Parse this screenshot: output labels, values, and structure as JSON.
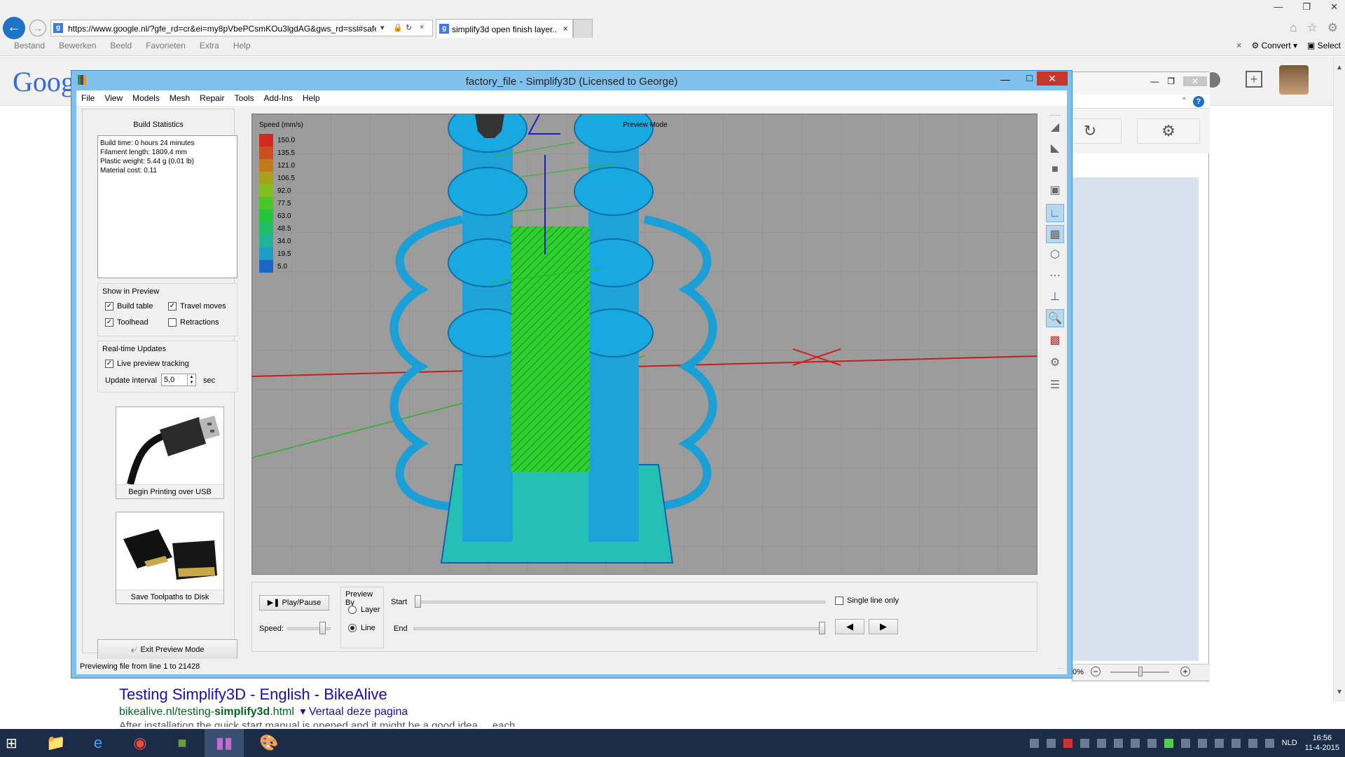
{
  "browser": {
    "url": "https://www.google.nl/?gfe_rd=cr&ei=my8pVbePCsmKOu3lgdAG&gws_rd=ssl#safe=of",
    "tab_title": "simplify3d open finish layer...",
    "menu": [
      "Bestand",
      "Bewerken",
      "Beeld",
      "Favorieten",
      "Extra",
      "Help"
    ],
    "convert_label": "Convert",
    "select_label": "Select"
  },
  "google": {
    "logo": "Goog",
    "result": {
      "title": "Testing Simplify3D - English - BikeAlive",
      "url_prefix": "bikealive.nl/testing-",
      "url_bold": "simplify3d",
      "url_suffix": ".html",
      "translate": "Vertaal deze pagina",
      "snippet": "After installation the quick start manual is opened and it might be a good idea ... each"
    },
    "zoom_pct": "0%"
  },
  "app": {
    "title": "factory_file - Simplify3D (Licensed to George)",
    "menu": [
      "File",
      "View",
      "Models",
      "Mesh",
      "Repair",
      "Tools",
      "Add-Ins",
      "Help"
    ],
    "status": "Previewing file from line 1 to 21428"
  },
  "build_stats": {
    "title": "Build Statistics",
    "lines": [
      "Build time: 0 hours 24 minutes",
      "Filament length: 1809.4 mm",
      "Plastic weight: 5.44 g (0.01 lb)",
      "Material cost: 0.11"
    ]
  },
  "show_in_preview": {
    "title": "Show in Preview",
    "build_table": {
      "label": "Build table",
      "checked": true
    },
    "travel_moves": {
      "label": "Travel moves",
      "checked": true
    },
    "toolhead": {
      "label": "Toolhead",
      "checked": true
    },
    "retractions": {
      "label": "Retractions",
      "checked": false
    }
  },
  "realtime": {
    "title": "Real-time Updates",
    "live_preview": {
      "label": "Live preview tracking",
      "checked": true
    },
    "interval_label": "Update interval",
    "interval_value": "5,0",
    "interval_unit": "sec"
  },
  "actions": {
    "usb_label": "Begin Printing over USB",
    "sd_label": "Save Toolpaths to Disk",
    "exit_label": "Exit Preview Mode"
  },
  "viewport": {
    "mode_label": "Preview Mode",
    "legend_title": "Speed (mm/s)",
    "legend": [
      {
        "value": "150.0",
        "color": "#d42a1e"
      },
      {
        "value": "135.5",
        "color": "#c9501c"
      },
      {
        "value": "121.0",
        "color": "#bf7a1a"
      },
      {
        "value": "106.5",
        "color": "#a6a21e"
      },
      {
        "value": "92.0",
        "color": "#7fbf22"
      },
      {
        "value": "77.5",
        "color": "#4cc526"
      },
      {
        "value": "63.0",
        "color": "#26c43a"
      },
      {
        "value": "48.5",
        "color": "#22bc6a"
      },
      {
        "value": "34.0",
        "color": "#21b29a"
      },
      {
        "value": "19.5",
        "color": "#1f9cc8"
      },
      {
        "value": "5.0",
        "color": "#1a66c7"
      }
    ]
  },
  "controls": {
    "play_pause_label": "Play/Pause",
    "speed_label": "Speed:",
    "preview_by_title": "Preview By",
    "layer_label": "Layer",
    "line_label": "Line",
    "preview_by_selected": "Line",
    "start_label": "Start",
    "end_label": "End",
    "single_line_label": "Single line only",
    "single_line_checked": false,
    "start_position": 0,
    "end_position": 1
  },
  "taskbar": {
    "language": "NLD",
    "time": "16:56",
    "date": "11-4-2015"
  }
}
